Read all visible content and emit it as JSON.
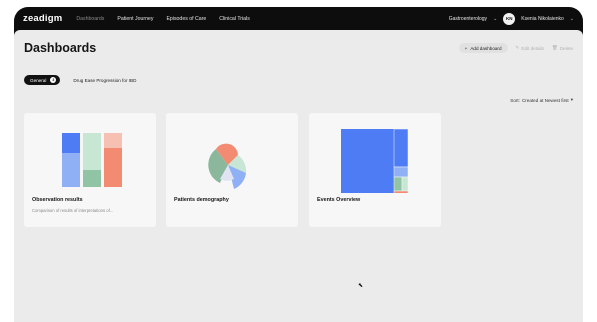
{
  "app": {
    "logo": "zeadigm",
    "nav": [
      {
        "label": "Dashboards",
        "active": true
      },
      {
        "label": "Patient Journey",
        "active": false
      },
      {
        "label": "Episodes of Care",
        "active": false
      },
      {
        "label": "Clinical Trials",
        "active": false
      }
    ],
    "department": "Gastroenterology",
    "user_initials": "KN",
    "user_name": "Ksenia Nikolaienko"
  },
  "page": {
    "title": "Dashboards",
    "add_dashboard": "Add dashboard",
    "edit_details": "Edit details",
    "delete": "Delete",
    "tabs": [
      {
        "label": "General",
        "count": "3",
        "active": true
      },
      {
        "label": "Drug Ease Progression for IBD",
        "active": false
      }
    ],
    "sort_label": "Sort:",
    "sort_value": "Created at Newest first"
  },
  "cards": [
    {
      "title": "Observation results",
      "subtitle": "Comparison of results of interpretations of..."
    },
    {
      "title": "Patients demography",
      "subtitle": ""
    },
    {
      "title": "Events Overview",
      "subtitle": ""
    }
  ],
  "colors": {
    "blue": "#4d7cf5",
    "blue_light": "#8fb0f4",
    "green": "#91c4a5",
    "green_light": "#c7e6d3",
    "salmon": "#f38a72",
    "salmon_light": "#f6c0b2",
    "green_dark": "#8bb89c"
  }
}
